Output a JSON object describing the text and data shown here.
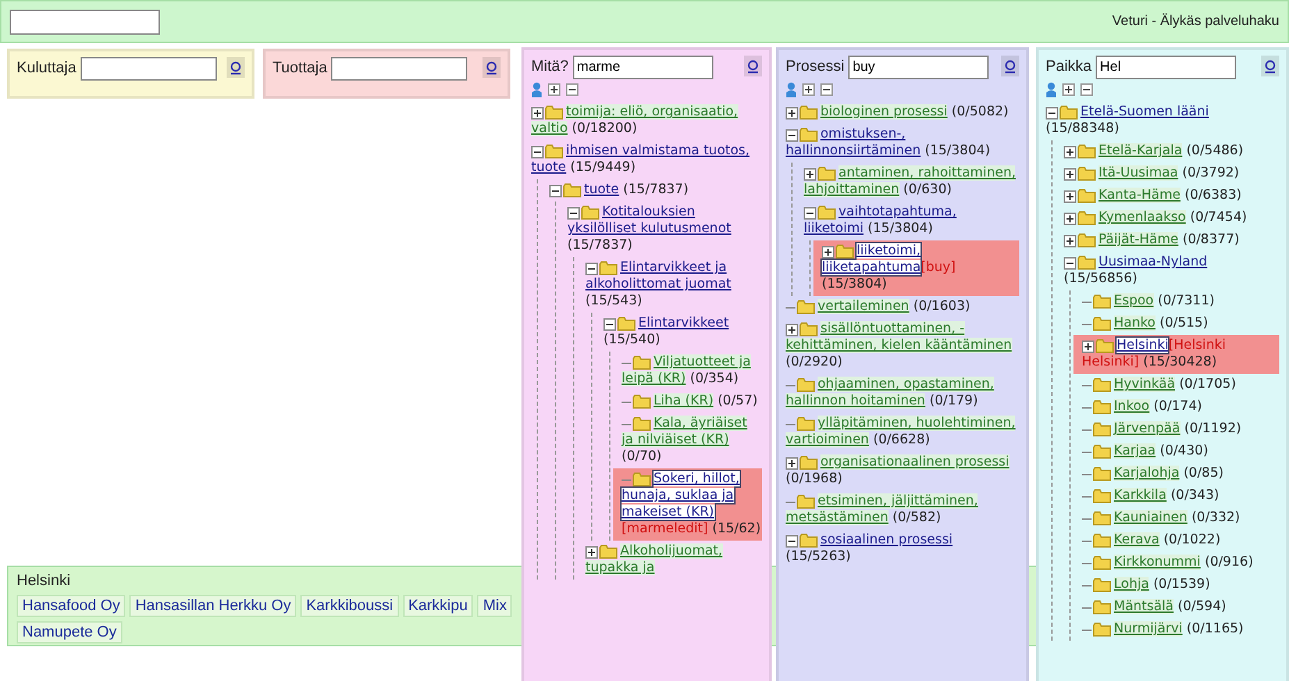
{
  "top_bar": {
    "title": "Veturi - Älykäs palveluhaku"
  },
  "filters": [
    {
      "label": "Kuluttaja",
      "color": "#fbf8d2"
    },
    {
      "label": "Tuottaja",
      "color": "#fbd8d8"
    }
  ],
  "trees": [
    {
      "label": "Mitä?",
      "value": "marme",
      "color": "#f7d6f7",
      "nodes": [
        {
          "label": "toimija: eliö, organisaatio, valtio",
          "count": "(0/18200)",
          "hits": false,
          "expanded": false,
          "selected": false
        },
        {
          "label": "ihmisen valmistama tuotos, tuote",
          "count": "(15/9449)",
          "hits": true,
          "expanded": true,
          "selected": false,
          "children": [
            {
              "label": "tuote",
              "count": "(15/7837)",
              "hits": true,
              "expanded": true,
              "selected": false,
              "children": [
                {
                  "label": "Kotitalouksien yksilölliset kulutusmenot",
                  "count": "(15/7837)",
                  "hits": true,
                  "expanded": true,
                  "selected": false,
                  "children": [
                    {
                      "label": "Elintarvikkeet ja alkoholittomat juomat",
                      "count": "(15/543)",
                      "hits": true,
                      "expanded": true,
                      "selected": false,
                      "children": [
                        {
                          "label": "Elintarvikkeet",
                          "count": "(15/540)",
                          "hits": true,
                          "expanded": true,
                          "selected": false,
                          "children": [
                            {
                              "label": "Viljatuotteet ja leipä (KR)",
                              "count": "(0/354)",
                              "hits": false,
                              "selected": false
                            },
                            {
                              "label": "Liha (KR)",
                              "count": "(0/57)",
                              "hits": false,
                              "selected": false
                            },
                            {
                              "label": "Kala, äyriäiset ja nilviäiset (KR)",
                              "count": "(0/70)",
                              "hits": false,
                              "selected": false
                            },
                            {
                              "label": "Sokeri, hillot, hunaja, suklaa ja makeiset (KR)",
                              "match": "[marmeledit]",
                              "count": "(15/62)",
                              "hits": true,
                              "selected": true
                            }
                          ]
                        }
                      ]
                    },
                    {
                      "label": "Alkoholijuomat, tupakka ja",
                      "hits": false,
                      "expanded": false,
                      "selected": false
                    }
                  ]
                }
              ]
            }
          ]
        }
      ]
    },
    {
      "label": "Prosessi",
      "value": "buy",
      "color": "#dadaf8",
      "nodes": [
        {
          "label": "biologinen prosessi",
          "count": "(0/5082)",
          "hits": false,
          "expanded": false,
          "selected": false
        },
        {
          "label": "omistuksen-, hallinnonsiirtäminen",
          "count": "(15/3804)",
          "hits": true,
          "expanded": true,
          "selected": false,
          "children": [
            {
              "label": "antaminen, rahoittaminen, lahjoittaminen",
              "count": "(0/630)",
              "hits": false,
              "expanded": false,
              "selected": false
            },
            {
              "label": "vaihtotapahtuma, liiketoimi",
              "count": "(15/3804)",
              "hits": true,
              "expanded": true,
              "selected": false,
              "children": [
                {
                  "label": "liiketoimi, liiketapahtuma",
                  "match": "[buy]",
                  "count": "(15/3804)",
                  "hits": true,
                  "expanded": false,
                  "selected": true
                }
              ]
            }
          ]
        },
        {
          "label": "vertaileminen",
          "count": "(0/1603)",
          "hits": false,
          "selected": false
        },
        {
          "label": "sisällöntuottaminen, -kehittäminen, kielen kääntäminen",
          "count": "(0/2920)",
          "hits": false,
          "expanded": false,
          "selected": false
        },
        {
          "label": "ohjaaminen, opastaminen, hallinnon hoitaminen",
          "count": "(0/179)",
          "hits": false,
          "selected": false
        },
        {
          "label": "ylläpitäminen, huolehtiminen, vartioiminen",
          "count": "(0/6628)",
          "hits": false,
          "selected": false
        },
        {
          "label": "organisationaalinen prosessi",
          "count": "(0/1968)",
          "hits": false,
          "expanded": false,
          "selected": false
        },
        {
          "label": "etsiminen, jäljittäminen, metsästäminen",
          "count": "(0/582)",
          "hits": false,
          "selected": false
        },
        {
          "label": "sosiaalinen prosessi",
          "count": "(15/5263)",
          "hits": true,
          "expanded": true,
          "selected": false
        }
      ]
    },
    {
      "label": "Paikka",
      "value": "Hel",
      "color": "#dcf8f8",
      "nodes": [
        {
          "label": "Etelä-Suomen lääni",
          "count": "(15/88348)",
          "hits": true,
          "expanded": true,
          "selected": false,
          "children": [
            {
              "label": "Etelä-Karjala",
              "count": "(0/5486)",
              "hits": false,
              "expanded": false,
              "selected": false
            },
            {
              "label": "Itä-Uusimaa",
              "count": "(0/3792)",
              "hits": false,
              "expanded": false,
              "selected": false
            },
            {
              "label": "Kanta-Häme",
              "count": "(0/6383)",
              "hits": false,
              "expanded": false,
              "selected": false
            },
            {
              "label": "Kymenlaakso",
              "count": "(0/7454)",
              "hits": false,
              "expanded": false,
              "selected": false
            },
            {
              "label": "Päijät-Häme",
              "count": "(0/8377)",
              "hits": false,
              "expanded": false,
              "selected": false
            },
            {
              "label": "Uusimaa-Nyland",
              "count": "(15/56856)",
              "hits": true,
              "expanded": true,
              "selected": false,
              "children": [
                {
                  "label": "Espoo",
                  "count": "(0/7311)",
                  "hits": false,
                  "selected": false
                },
                {
                  "label": "Hanko",
                  "count": "(0/515)",
                  "hits": false,
                  "selected": false
                },
                {
                  "label": "Helsinki",
                  "match": "[Helsinki Helsinki]",
                  "count": "(15/30428)",
                  "hits": true,
                  "expanded": false,
                  "selected": true
                },
                {
                  "label": "Hyvinkää",
                  "count": "(0/1705)",
                  "hits": false,
                  "selected": false
                },
                {
                  "label": "Inkoo",
                  "count": "(0/174)",
                  "hits": false,
                  "selected": false
                },
                {
                  "label": "Järvenpää",
                  "count": "(0/1192)",
                  "hits": false,
                  "selected": false
                },
                {
                  "label": "Karjaa",
                  "count": "(0/430)",
                  "hits": false,
                  "selected": false
                },
                {
                  "label": "Karjalohja",
                  "count": "(0/85)",
                  "hits": false,
                  "selected": false
                },
                {
                  "label": "Karkkila",
                  "count": "(0/343)",
                  "hits": false,
                  "selected": false
                },
                {
                  "label": "Kauniainen",
                  "count": "(0/332)",
                  "hits": false,
                  "selected": false
                },
                {
                  "label": "Kerava",
                  "count": "(0/1022)",
                  "hits": false,
                  "selected": false
                },
                {
                  "label": "Kirkkonummi",
                  "count": "(0/916)",
                  "hits": false,
                  "selected": false
                },
                {
                  "label": "Lohja",
                  "count": "(0/1539)",
                  "hits": false,
                  "selected": false
                },
                {
                  "label": "Mäntsälä",
                  "count": "(0/594)",
                  "hits": false,
                  "selected": false
                },
                {
                  "label": "Nurmijärvi",
                  "count": "(0/1165)",
                  "hits": false,
                  "selected": false
                }
              ]
            }
          ]
        }
      ]
    }
  ],
  "results": {
    "title": "Helsinki",
    "items": [
      "Hansafood Oy",
      "Hansasillan Herkku Oy",
      "Karkkiboussi",
      "Karkkipu",
      "Mix",
      "Namupete Oy"
    ]
  }
}
